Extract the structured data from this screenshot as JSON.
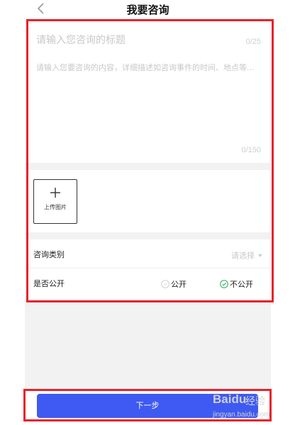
{
  "header": {
    "back_icon": "chevron-left-icon",
    "title": "我要咨询"
  },
  "form": {
    "title_placeholder": "请输入您咨询的标题",
    "title_counter": "0/25",
    "content_placeholder": "请输入您要咨询的内容，详细描述如咨询事件的时间、地点等...",
    "content_counter": "0/150",
    "upload_label": "上传图片",
    "upload_icon": "plus-icon",
    "category_label": "咨询类别",
    "category_placeholder": "请选择",
    "category_caret_icon": "caret-down-icon",
    "public_label": "是否公开",
    "public_options": [
      {
        "label": "公开",
        "selected": false
      },
      {
        "label": "不公开",
        "selected": true
      }
    ]
  },
  "footer": {
    "next_label": "下一步"
  },
  "watermark": {
    "logo": "Baidu",
    "text": "经验",
    "url": "jingyan.baidu.com"
  },
  "colors": {
    "primary_button": "#3f5af2",
    "radio_selected": "#2ba866",
    "radio_unselected": "#cccccc",
    "annotation_box": "#e8222b"
  }
}
